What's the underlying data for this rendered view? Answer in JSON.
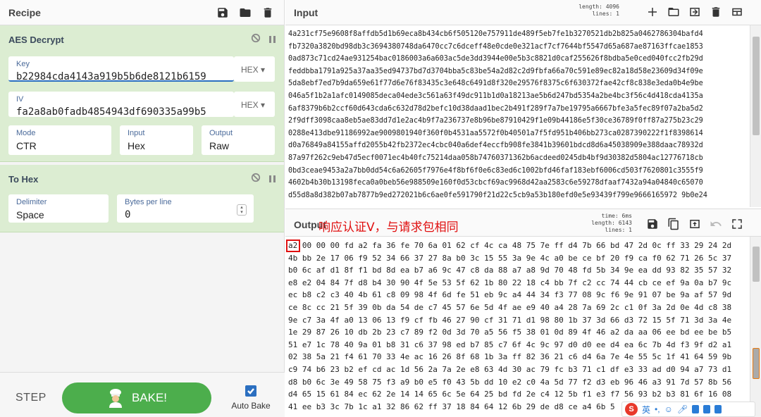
{
  "recipe": {
    "title": "Recipe",
    "icons": [
      "save-icon",
      "folder-icon",
      "trash-icon"
    ],
    "operations": [
      {
        "name": "AES Decrypt",
        "key_label": "Key",
        "key_value": "b22984cda4143a919b5b6de8121b6159",
        "key_type": "HEX",
        "iv_label": "IV",
        "iv_value": "fa2a8ab0fadb4854943df690335a99b5",
        "iv_type": "HEX",
        "mode_label": "Mode",
        "mode_value": "CTR",
        "input_label": "Input",
        "input_value": "Hex",
        "output_label": "Output",
        "output_value": "Raw"
      },
      {
        "name": "To Hex",
        "delimiter_label": "Delimiter",
        "delimiter_value": "Space",
        "bpl_label": "Bytes per line",
        "bpl_value": "0"
      }
    ]
  },
  "bake": {
    "step_label": "STEP",
    "bake_label": "BAKE!",
    "auto_label": "Auto Bake",
    "auto_checked": true
  },
  "input": {
    "title": "Input",
    "length_label": "length:",
    "length_value": "4096",
    "lines_label": "lines:",
    "lines_value": "1",
    "lines": [
      "4a231cf75e9608f8affdb5d1b69eca8b434cb6f505120e757911de489f5eb7fe1b3270521db2b825a0462786304bafd4",
      "fb7320a3820bd98db3c3694380748da6470cc7c6dceff48e0cde0e321acf7cf7644bf5547d65a687ae87163ffcae1853",
      "0ad873c71cd24ae931254bac0186003a6a603ac5de3dd3944e00e5b3c8821d0caf255626f8bdba5e0ced040fcc2fb29d",
      "feddbba1791a925a37aa35ed94737bd7d3704bba5c83be54a2d82c2d9fbfa66a70c591e89ec82a18d58e23609d34f09e",
      "5da8ebf7ed7b9da659e61f77d6e76f83435c3e648c6491d8f320e29576f8375c6f630372fae42cf8c838e3eda0b4e9be",
      "046a5f1b2a1afc0149085deca04ede3c561a63f49dc911b1d0a18213ae5b6d247bd5354a2be4bc3f56c4d418cda4135a",
      "6af8379b6b2ccf60d643cda6c632d78d2befc10d38daad1bec2b491f289f7a7be19795a6667bfe3a5fec89f07a2ba5d2",
      "2f9dff3098caa8eb5ae83dd7d1e2ac4b9f7a236737e8b96be87910429f1e09b44186e5f30ce36789f0ff87a275b23c29",
      "0288e413dbe91186992ae9009801940f360f0b4531aa5572f0b40501a7f5fd951b406bb273ca0287390222f1f8398614",
      "d0a76849a84155affd2055b42fb2372ec4cbc040a6def4eccfb908fe3841b39601bdcd8d6a45038909e388daac78932d",
      "87a97f262c9eb47d5ecf0071ec4b40fc75214daa058b74760371362b6acdeed0245db4bf9d30382d5804ac12776718cb",
      "0bd3ceae9453a2a7bb0dd54c6a62605f7976e4f8bf6f0e6c83ed6c1002bfd46faf183ebf6006cd503f7620801c3555f9",
      "4602b4b30b13198feca0a0beb56e988509e160f0d53cbcf69ac9968d42aa2583c6e59278dfaaf7432a94a04840c65070",
      "d55d8a8d382b07ab7877b9ed272021b6c6ae0fe591790f21d22c5cb9a53b180efd0e5e93439f799e9666165972 9b0e24"
    ]
  },
  "output": {
    "title": "Output",
    "time_label": "time:",
    "time_value": "6ms",
    "length_label": "length:",
    "length_value": "6143",
    "lines_label": "lines:",
    "lines_value": "1",
    "annotation": "响应认证V，与请求包相同",
    "lines": [
      "a2 00 00 00 fd a2 fa 36 fe 70 6a 01 62 cf 4c ca 48 75 7e ff d4 7b 66 bd 47 2d 0c ff 33 29 24 2d",
      "4b bb 2e 17 06 f9 52 34 66 37 27 8a b0 3c 15 55 3a 9e 4c a0 be ce bf 20 f9 ca f0 62 71 26 5c 37",
      "b0 6c af d1 8f f1 bd 8d ea b7 a6 9c 47 c8 da 88 a7 a8 9d 70 48 fd 5b 34 9e ea dd 93 82 35 57 32",
      "e8 e2 04 84 7f d8 b4 30 90 4f 5e 53 5f 62 1b 80 22 18 c4 bb 7f c2 cc 74 44 cb ce ef 9a 0a b7 9c",
      "ec b8 c2 c3 40 4b 61 c8 09 98 4f 6d fe 51 eb 9c a4 44 34 f3 77 08 9c f6 9e 91 07 be 9a af 57 9d",
      "ce 8c cc 21 5f 39 0b da 54 de c7 45 57 6e 5d 4f ae e9 40 a4 28 7a 69 2c c1 0f 3a 2d 0e 4d c8 38",
      "9e c7 3a 4f a0 13 06 13 f9 cf fb 46 27 90 cf 31 71 d1 98 80 1b 37 3d 66 d3 72 15 5f 71 3d 3a 4e",
      "1e 29 87 26 10 db 2b 23 c7 89 f2 0d 3d 70 a5 56 f5 38 01 0d 89 4f 46 a2 da aa 06 ee bd ee be b5",
      "51 e7 1c 78 40 9a 01 b8 31 c6 37 98 ed b7 85 c7 6f 4c 9c 97 d0 d0 ee d4 ea 6c 7b 4d f3 9f d2 a1",
      "02 38 5a 21 f4 61 70 33 4e ac 16 26 8f 68 1b 3a ff 82 36 21 c6 d4 6a 7e 4e 55 5c 1f 41 64 59 9b",
      "c9 74 b6 23 b2 ef cd ac 1d 56 2a 7a 2e e8 63 4d 30 ac 79 fc b3 71 c1 df e3 33 ad d0 94 a7 73 d1",
      "d8 b0 6c 3e 49 58 75 f3 a9 b0 e5 f0 43 5b dd 10 e2 c0 4a 5d 77 f2 d3 eb 96 46 a3 91 7d 57 8b 56",
      "d4 65 15 61 84 ec 62 2e 14 14 65 6c 5e 64 25 bd fd 2e c4 12 5b f1 e3 f7 56 93 b2 b3 81 6f 16 08",
      "41 ee b3 3c 7b 1c a1 32 86 62 ff 37 18 84 64 12 6b 29 de d8 ce a4 6b 5"
    ]
  },
  "ime": {
    "logo": "S",
    "lang": "英"
  },
  "colors": {
    "op_bg": "#dcedd2",
    "bake_green": "#4cae4c",
    "annotation_red": "#e01010",
    "accent_blue": "#2b6fc0"
  }
}
